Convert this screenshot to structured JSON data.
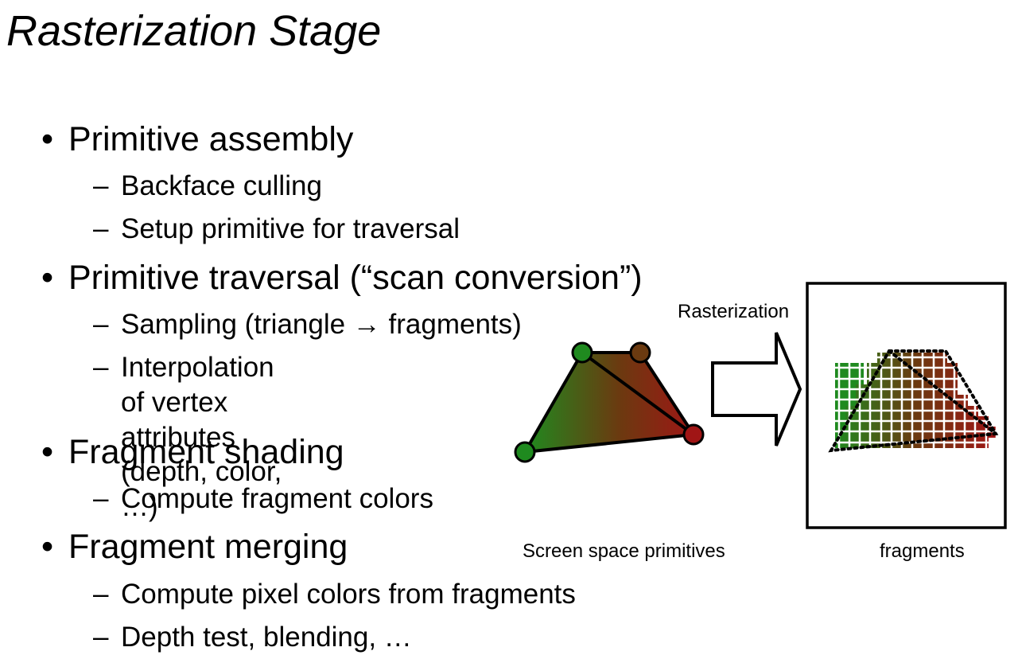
{
  "slide": {
    "title": "Rasterization Stage"
  },
  "bullets": [
    {
      "text": "Primitive assembly",
      "sub": [
        "Backface culling",
        "Setup primitive for traversal"
      ]
    },
    {
      "text": "Primitive traversal (“scan conversion”)",
      "sub": [
        "Sampling (triangle → fragments)",
        "Interpolation of vertex\nattributes (depth, color, …)"
      ]
    },
    {
      "text": "Fragment shading",
      "sub": [
        "Compute fragment colors"
      ]
    },
    {
      "text": "Fragment merging",
      "sub": [
        "Compute pixel colors from fragments",
        "Depth test, blending, …"
      ]
    }
  ],
  "bullet_glyph": "•",
  "sub_glyph": "–",
  "diagram": {
    "arrow_label": "Rasterization",
    "left_caption": "Screen space primitives",
    "right_caption": "fragments",
    "colors": {
      "green": "#1f8a1f",
      "brown": "#6b3a10",
      "red": "#a01515",
      "grid_line": "#000000"
    }
  }
}
